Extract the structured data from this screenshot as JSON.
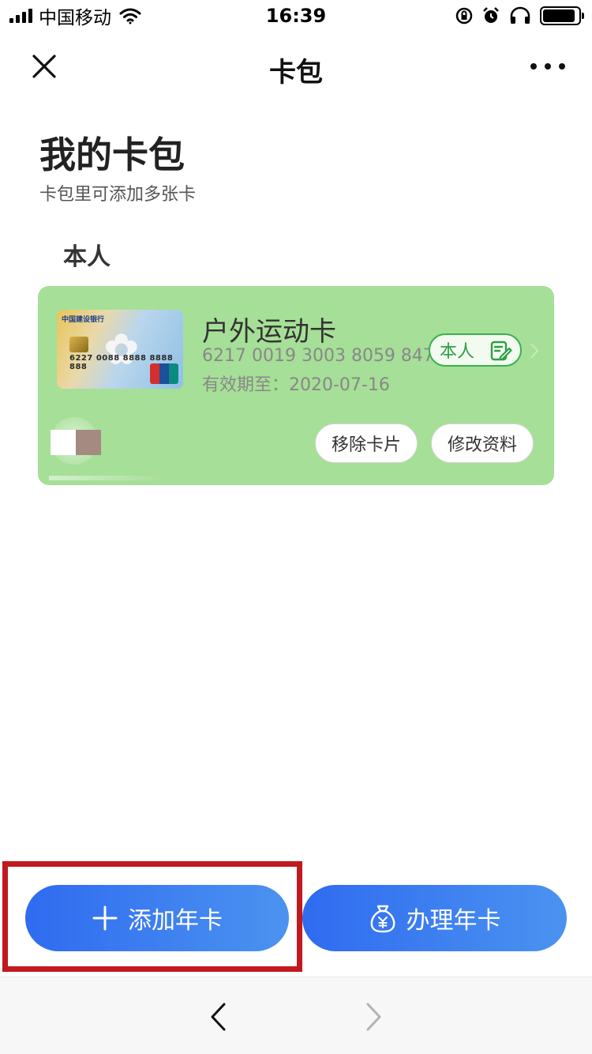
{
  "status_bar": {
    "carrier": "中国移动",
    "time": "16:39",
    "battery_level": 0.9
  },
  "nav": {
    "title": "卡包",
    "close_icon": "close-icon",
    "more_icon": "more-dots-icon"
  },
  "header": {
    "title": "我的卡包",
    "subtitle": "卡包里可添加多张卡"
  },
  "section": {
    "label": "本人"
  },
  "card": {
    "thumb_bank_text": "中国建设银行",
    "thumb_number": "6227 0088 8888 8888 888",
    "name": "户外运动卡",
    "number": "6217 0019 3003 8059 847",
    "expiry": "有效期至：2020-07-16",
    "badge_label": "本人",
    "badge_icon": "edit-note-icon",
    "remove_label": "移除卡片",
    "edit_label": "修改资料",
    "colors": {
      "card_bg": "#a6df97",
      "badge_green": "#2f9e44"
    }
  },
  "actions": {
    "add_label": "添加年卡",
    "apply_label": "办理年卡",
    "add_icon": "plus-icon",
    "apply_icon": "money-bag-icon",
    "accent": "#2f6bf0"
  },
  "toolbar": {
    "back_icon": "chevron-left-icon",
    "forward_icon": "chevron-right-icon"
  }
}
